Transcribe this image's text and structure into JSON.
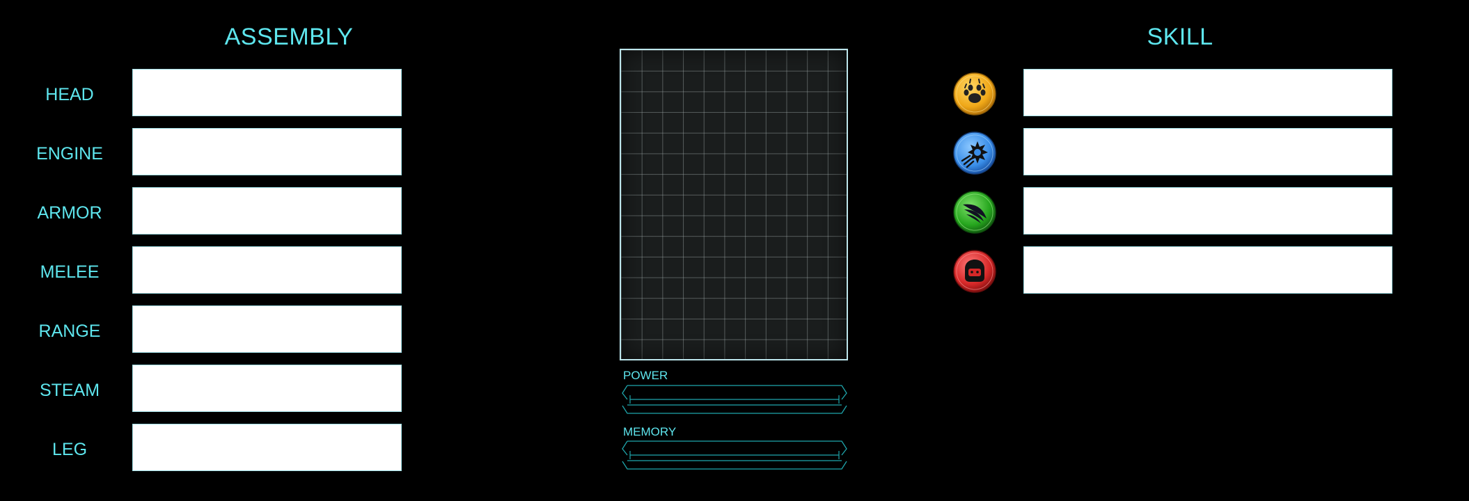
{
  "assembly": {
    "title": "ASSEMBLY",
    "slots": [
      {
        "label": "HEAD",
        "value": ""
      },
      {
        "label": "ENGINE",
        "value": ""
      },
      {
        "label": "ARMOR",
        "value": ""
      },
      {
        "label": "MELEE",
        "value": ""
      },
      {
        "label": "RANGE",
        "value": ""
      },
      {
        "label": "STEAM",
        "value": ""
      },
      {
        "label": "LEG",
        "value": ""
      }
    ]
  },
  "skill": {
    "title": "SKILL",
    "items": [
      {
        "icon": "paw-icon",
        "color": "#f0b020",
        "value": ""
      },
      {
        "icon": "comet-icon",
        "color": "#3a8ee8",
        "value": ""
      },
      {
        "icon": "wing-icon",
        "color": "#26a61e",
        "value": ""
      },
      {
        "icon": "helmet-icon",
        "color": "#d62828",
        "value": ""
      }
    ]
  },
  "meters": {
    "power_label": "POWER",
    "memory_label": "MEMORY",
    "power_level": 0,
    "memory_level": 0
  },
  "colors": {
    "accent": "#5ee6ee",
    "background": "#000000",
    "grid_bg": "#1a1d1d"
  }
}
